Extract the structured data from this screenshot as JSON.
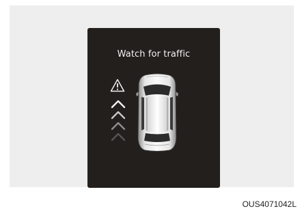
{
  "display": {
    "message": "Watch for traffic",
    "warning_icon": "warning-triangle-icon",
    "arrow_icon": "chevron-up-icon",
    "vehicle_icon": "car-top-view-icon",
    "accent_color": "#ffffff",
    "background_color": "#221f1d"
  },
  "image_code": "OUS4071042L"
}
